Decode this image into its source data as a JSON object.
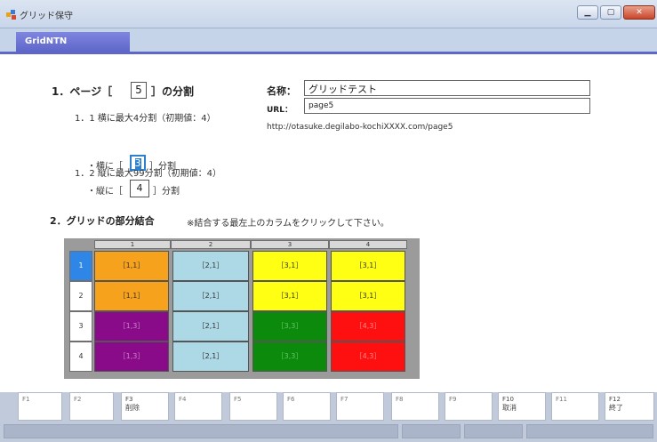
{
  "window": {
    "title": "グリッド保守",
    "icons": {
      "app": "app-icon",
      "minimize": "minimize-icon",
      "maximize": "maximize-icon",
      "close": "close-icon"
    }
  },
  "tab": {
    "label": "GridNTN"
  },
  "section1": {
    "heading_pre": "1．ページ［",
    "page_value": "5",
    "heading_post": "］の分割",
    "sub1": "1．1 横に最大4分割（初期値：4）",
    "cols_pre": "・横に［",
    "cols_value": "3",
    "cols_post": "］分割",
    "sub2": "1．2 縦に最大99分割（初期値：4）",
    "rows_pre": "・縦に［",
    "rows_value": "4",
    "rows_post": "］分割"
  },
  "form": {
    "name_label": "名称：",
    "name_value": "グリッドテスト",
    "url_label": "URL：",
    "url_value": "page5",
    "full_url": "http://otasuke.degilabo-kochiXXXX.com/page5"
  },
  "section2": {
    "heading": "2．グリッドの部分結合",
    "note": "※結合する最左上のカラムをクリックして下さい。"
  },
  "grid": {
    "columns": [
      "1",
      "2",
      "3",
      "4"
    ],
    "rows": [
      {
        "num": "1",
        "cells": [
          "［1,1］",
          "［2,1］",
          "［3,1］",
          "［3,1］"
        ]
      },
      {
        "num": "2",
        "cells": [
          "［1,1］",
          "［2,1］",
          "［3,1］",
          "［3,1］"
        ]
      },
      {
        "num": "3",
        "cells": [
          "［1,3］",
          "［2,1］",
          "［3,3］",
          "［4,3］"
        ]
      },
      {
        "num": "4",
        "cells": [
          "［1,3］",
          "［2,1］",
          "［3,3］",
          "［4,3］"
        ]
      }
    ],
    "colors": {
      "orange": "#f7a21c",
      "light_blue": "#add8e6",
      "yellow": "#ffff14",
      "purple": "#8a0b8a",
      "green": "#0c8a0c",
      "red": "#ff1010",
      "active_row": "#2e86e6"
    }
  },
  "fkeys": [
    {
      "fn": "F1",
      "label": ""
    },
    {
      "fn": "F2",
      "label": ""
    },
    {
      "fn": "F3",
      "label": "削除"
    },
    {
      "fn": "F4",
      "label": ""
    },
    {
      "fn": "F5",
      "label": ""
    },
    {
      "fn": "F6",
      "label": ""
    },
    {
      "fn": "F7",
      "label": ""
    },
    {
      "fn": "F8",
      "label": ""
    },
    {
      "fn": "F9",
      "label": ""
    },
    {
      "fn": "F10",
      "label": "取消"
    },
    {
      "fn": "F11",
      "label": ""
    },
    {
      "fn": "F12",
      "label": "終了"
    }
  ]
}
